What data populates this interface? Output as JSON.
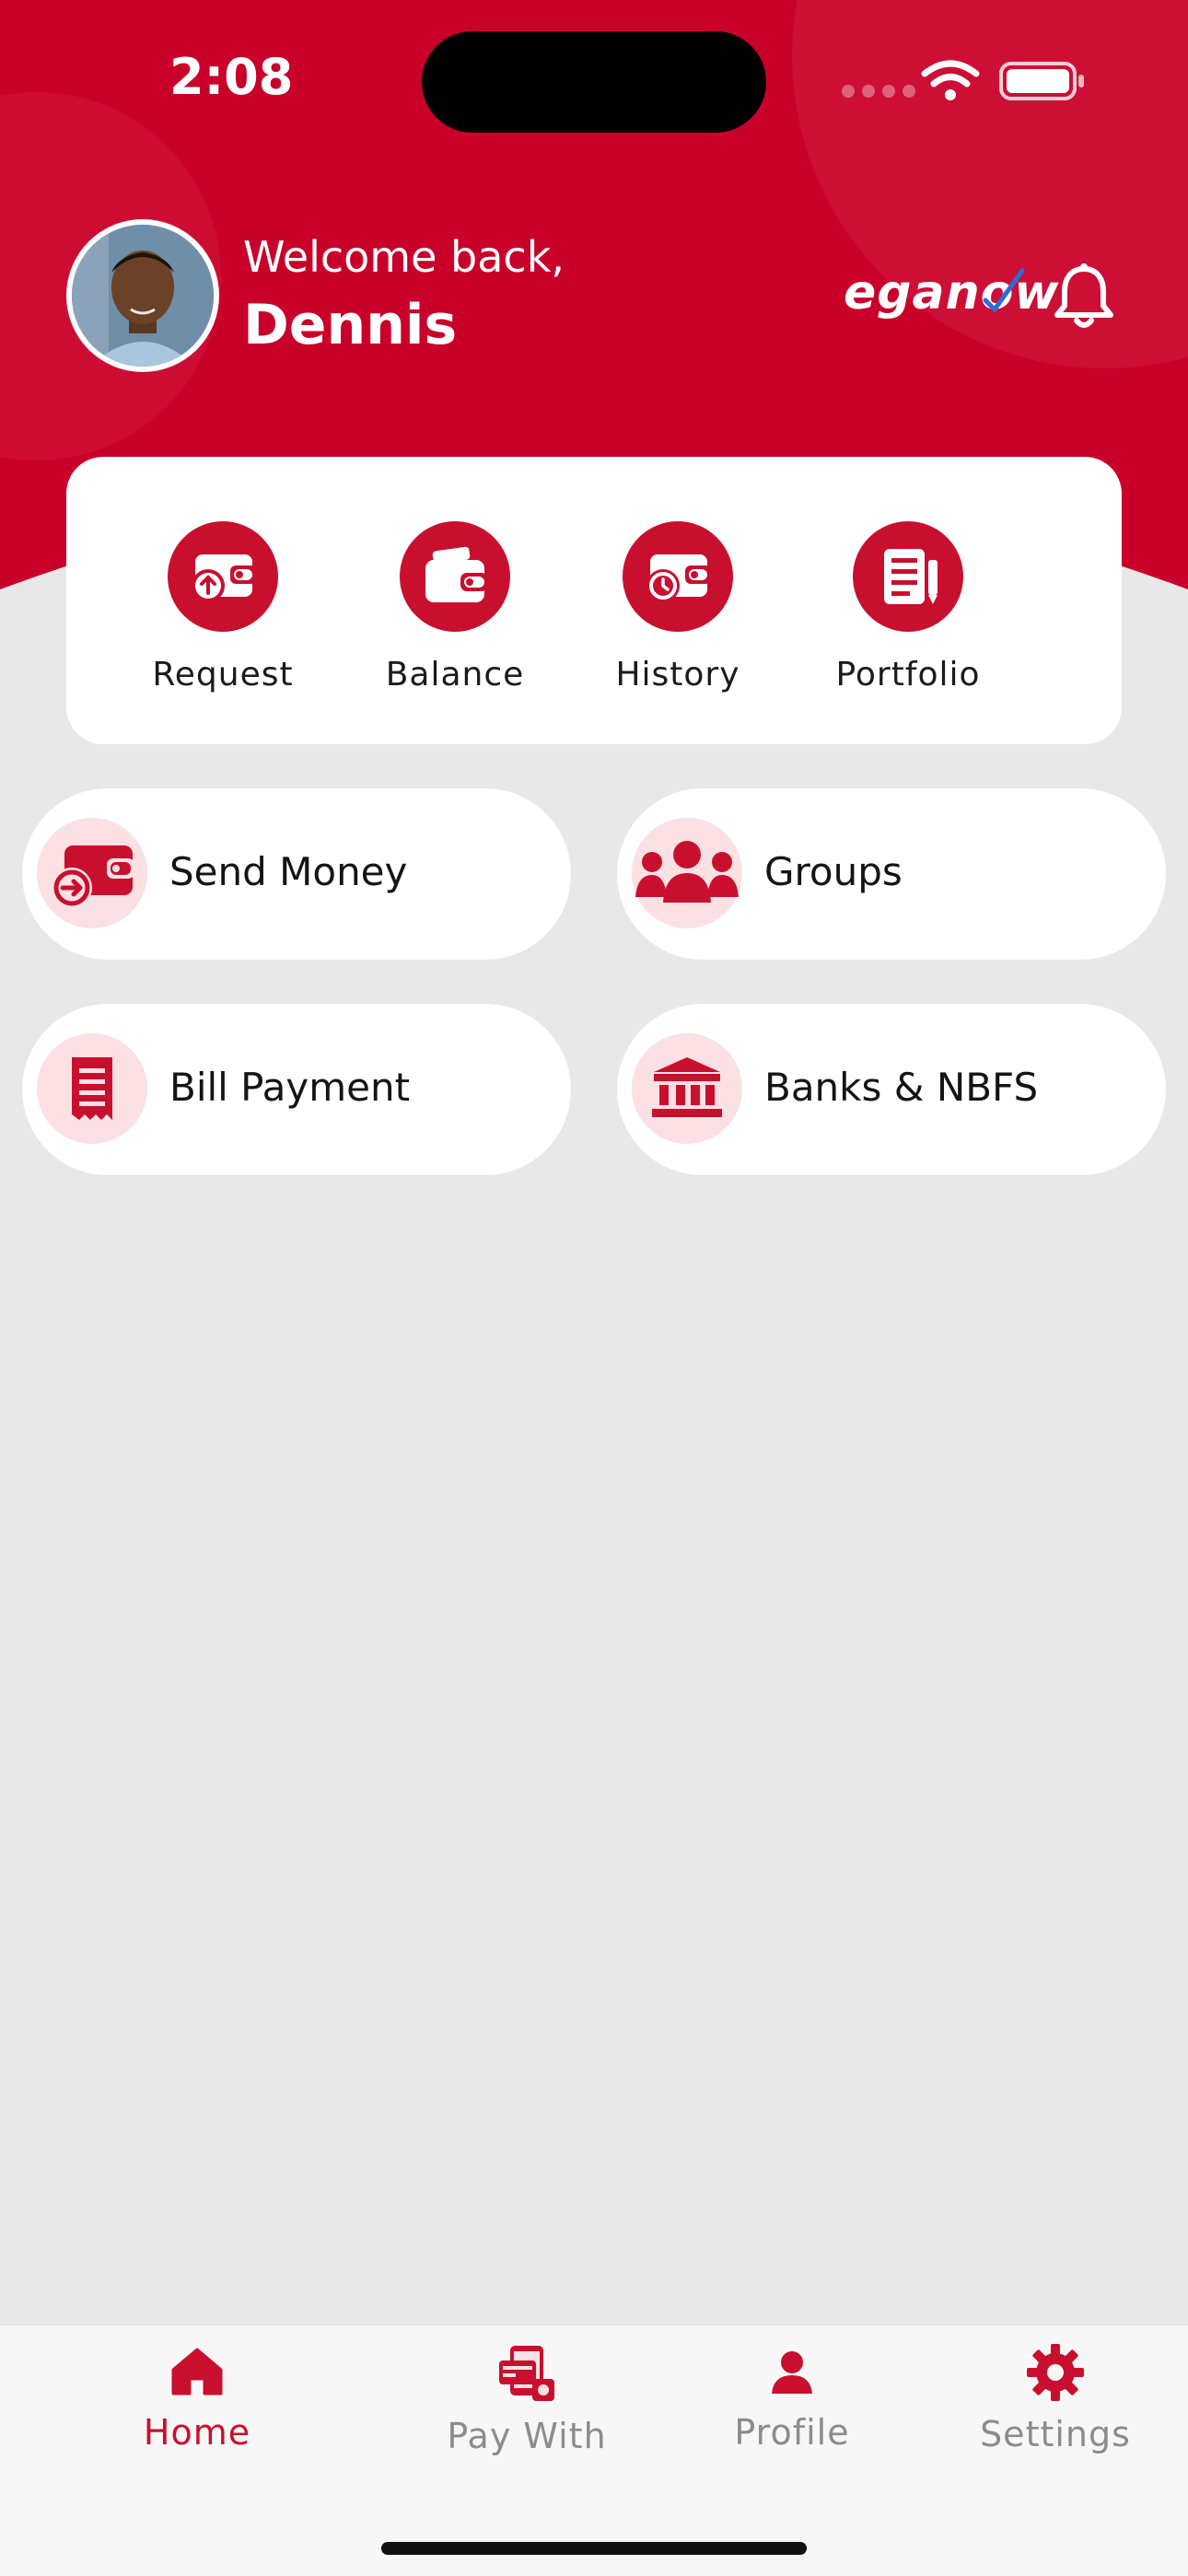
{
  "status_bar": {
    "time": "2:08",
    "icons": [
      "signal-icon",
      "wifi-icon",
      "battery-icon"
    ]
  },
  "header": {
    "welcome": "Welcome back,",
    "username": "Dennis",
    "brand": "eganow",
    "icons": [
      "avatar",
      "bell-icon"
    ]
  },
  "quick_actions": [
    {
      "label": "Request",
      "icon": "request-wallet-icon"
    },
    {
      "label": "Balance",
      "icon": "balance-wallet-icon"
    },
    {
      "label": "History",
      "icon": "history-wallet-icon"
    },
    {
      "label": "Portfolio",
      "icon": "portfolio-icon"
    }
  ],
  "services": [
    {
      "label": "Send Money",
      "icon": "send-money-icon"
    },
    {
      "label": "Groups",
      "icon": "groups-icon"
    },
    {
      "label": "Bill Payment",
      "icon": "bill-receipt-icon"
    },
    {
      "label": "Banks & NBFS",
      "icon": "bank-icon"
    }
  ],
  "bottom_nav": [
    {
      "label": "Home",
      "icon": "home-icon",
      "active": true
    },
    {
      "label": "Pay With",
      "icon": "pay-with-icon",
      "active": false
    },
    {
      "label": "Profile",
      "icon": "profile-icon",
      "active": false
    },
    {
      "label": "Settings",
      "icon": "settings-icon",
      "active": false
    }
  ],
  "colors": {
    "brand_red": "#c8102e",
    "background": "#e8e8e8",
    "inactive": "#8c8c8c",
    "icon_tint": "#fbe0e4"
  }
}
